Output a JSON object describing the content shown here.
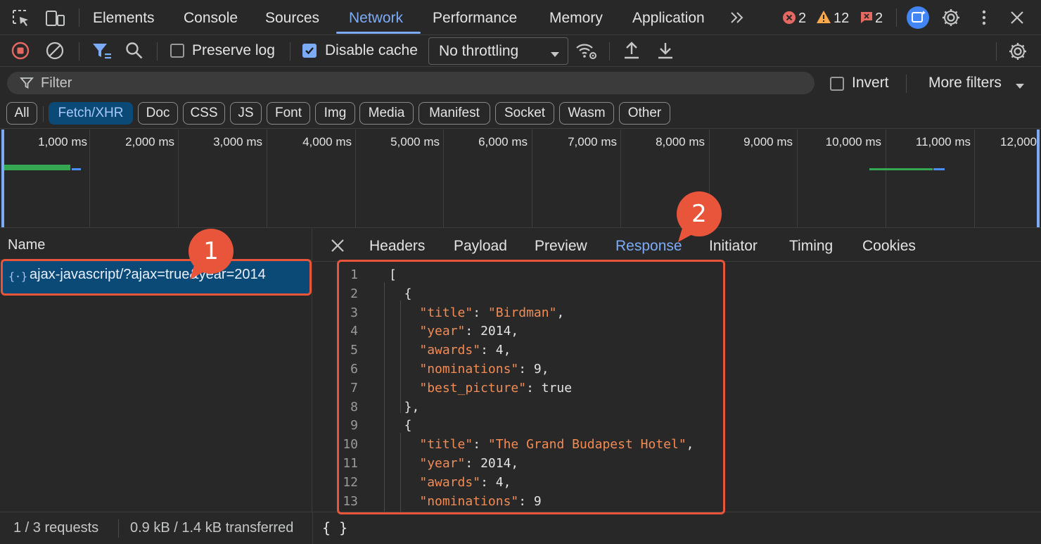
{
  "top_tabs": [
    {
      "label": "Elements"
    },
    {
      "label": "Console"
    },
    {
      "label": "Sources"
    },
    {
      "label": "Network"
    },
    {
      "label": "Performance"
    },
    {
      "label": "Memory"
    },
    {
      "label": "Application"
    }
  ],
  "active_top_tab": "Network",
  "counts": {
    "errors": "2",
    "warnings": "12",
    "issues": "2"
  },
  "toolbar": {
    "preserve_log": "Preserve log",
    "preserve_log_checked": false,
    "disable_cache": "Disable cache",
    "disable_cache_checked": true,
    "throttling": "No throttling"
  },
  "filter": {
    "placeholder": "Filter",
    "invert": "Invert",
    "more_filters": "More filters"
  },
  "type_filters": [
    "All",
    "Fetch/XHR",
    "Doc",
    "CSS",
    "JS",
    "Font",
    "Img",
    "Media",
    "Manifest",
    "Socket",
    "Wasm",
    "Other"
  ],
  "active_type_filter": "Fetch/XHR",
  "timeline_ticks": [
    "1,000 ms",
    "2,000 ms",
    "3,000 ms",
    "4,000 ms",
    "5,000 ms",
    "6,000 ms",
    "7,000 ms",
    "8,000 ms",
    "9,000 ms",
    "10,000 ms",
    "11,000 ms",
    "12,000"
  ],
  "requests": {
    "column_name": "Name",
    "items": [
      {
        "name": "ajax-javascript/?ajax=true&year=2014"
      }
    ]
  },
  "detail_tabs": [
    "Headers",
    "Payload",
    "Preview",
    "Response",
    "Initiator",
    "Timing",
    "Cookies"
  ],
  "active_detail_tab": "Response",
  "response_lines": [
    {
      "n": "1",
      "text": "["
    },
    {
      "n": "2",
      "text": "  {"
    },
    {
      "n": "3",
      "text": "    \"title\": \"Birdman\","
    },
    {
      "n": "4",
      "text": "    \"year\": 2014,"
    },
    {
      "n": "5",
      "text": "    \"awards\": 4,"
    },
    {
      "n": "6",
      "text": "    \"nominations\": 9,"
    },
    {
      "n": "7",
      "text": "    \"best_picture\": true"
    },
    {
      "n": "8",
      "text": "  },"
    },
    {
      "n": "9",
      "text": "  {"
    },
    {
      "n": "10",
      "text": "    \"title\": \"The Grand Budapest Hotel\","
    },
    {
      "n": "11",
      "text": "    \"year\": 2014,"
    },
    {
      "n": "12",
      "text": "    \"awards\": 4,"
    },
    {
      "n": "13",
      "text": "    \"nominations\": 9"
    }
  ],
  "status": {
    "requests": "1 / 3 requests",
    "transferred": "0.9 kB / 1.4 kB transferred",
    "pretty_print": "{ }"
  },
  "annotations": {
    "badge1": "1",
    "badge2": "2"
  },
  "colors": {
    "accent": "#7cacf8",
    "selection": "#0b4a77",
    "annotation": "#e8553a",
    "json_string": "#f28b54"
  }
}
